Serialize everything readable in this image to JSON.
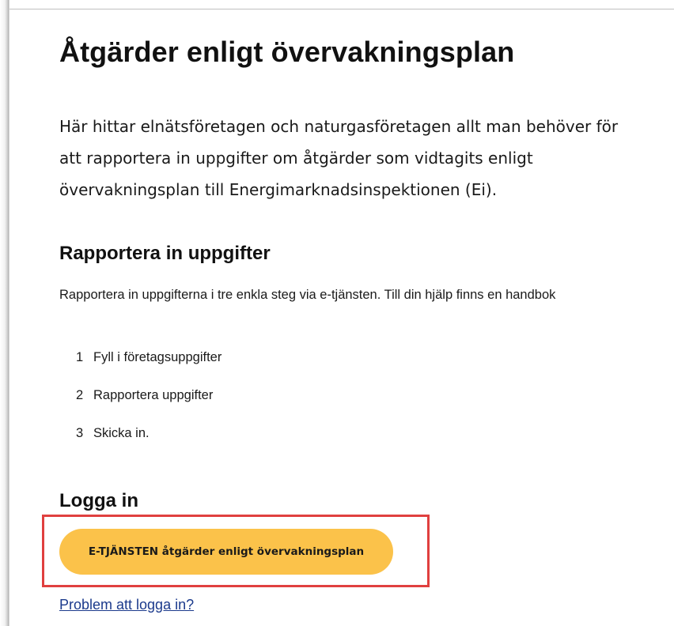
{
  "page": {
    "title": "Åtgärder enligt övervakningsplan",
    "intro_lines": [
      "Här hittar elnätsföretagen och naturgasföretagen allt man behöver för",
      "att rapportera in uppgifter om åtgärder som vidtagits enligt",
      "övervakningsplan till Energimarknadsinspektionen (Ei)."
    ]
  },
  "report_section": {
    "heading": "Rapportera in uppgifter",
    "text": "Rapportera in uppgifterna i tre enkla steg via e-tjänsten. Till din hjälp finns en handbok",
    "steps": [
      {
        "num": "1",
        "label": "Fyll i företagsuppgifter"
      },
      {
        "num": "2",
        "label": "Rapportera uppgifter"
      },
      {
        "num": "3",
        "label": "Skicka in."
      }
    ]
  },
  "login_section": {
    "heading": "Logga in",
    "button_label": "E-TJÄNSTEN åtgärder enligt övervakningsplan",
    "help_link": "Problem att logga in?"
  },
  "colors": {
    "button_bg": "#fbc24a",
    "highlight_border": "#e0403f",
    "link": "#1b3a8c"
  }
}
